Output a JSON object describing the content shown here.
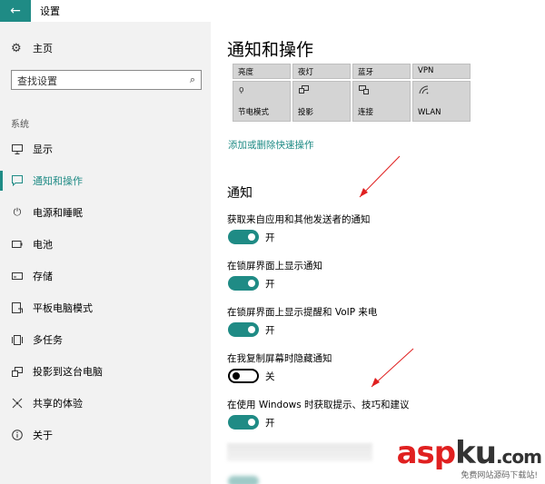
{
  "window": {
    "title": "设置",
    "back_icon": "arrow-left-icon"
  },
  "sidebar": {
    "home": {
      "label": "主页",
      "icon": "gear-icon"
    },
    "search": {
      "placeholder": "查找设置",
      "icon": "search-icon"
    },
    "section_label": "系统",
    "items": [
      {
        "label": "显示",
        "icon": "monitor-icon",
        "active": false
      },
      {
        "label": "通知和操作",
        "icon": "chat-icon",
        "active": true
      },
      {
        "label": "电源和睡眠",
        "icon": "power-icon",
        "active": false
      },
      {
        "label": "电池",
        "icon": "battery-icon",
        "active": false
      },
      {
        "label": "存储",
        "icon": "storage-icon",
        "active": false
      },
      {
        "label": "平板电脑模式",
        "icon": "tablet-icon",
        "active": false
      },
      {
        "label": "多任务",
        "icon": "multitask-icon",
        "active": false
      },
      {
        "label": "投影到这台电脑",
        "icon": "project-icon",
        "active": false
      },
      {
        "label": "共享的体验",
        "icon": "share-icon",
        "active": false
      },
      {
        "label": "关于",
        "icon": "info-icon",
        "active": false
      }
    ]
  },
  "main": {
    "title": "通知和操作",
    "quick_actions": {
      "row1": [
        "亮度",
        "夜灯",
        "蓝牙",
        "VPN"
      ],
      "row2": [
        "节电模式",
        "投影",
        "连接",
        "WLAN"
      ]
    },
    "edit_link": "添加或删除快速操作",
    "section_title": "通知",
    "settings": [
      {
        "label": "获取来自应用和其他发送者的通知",
        "state": "开",
        "on": true
      },
      {
        "label": "在锁屏界面上显示通知",
        "state": "开",
        "on": true
      },
      {
        "label": "在锁屏界面上显示提醒和 VoIP 来电",
        "state": "开",
        "on": true
      },
      {
        "label": "在我复制屏幕时隐藏通知",
        "state": "关",
        "on": false
      },
      {
        "label": "在使用 Windows 时获取提示、技巧和建议",
        "state": "开",
        "on": true
      }
    ]
  },
  "colors": {
    "accent": "#1f8b85",
    "arrow": "#e02020"
  },
  "watermark": {
    "brand_a": "asp",
    "brand_b": "ku",
    "suffix": ".com",
    "subtitle": "免费网站源码下载站!"
  }
}
